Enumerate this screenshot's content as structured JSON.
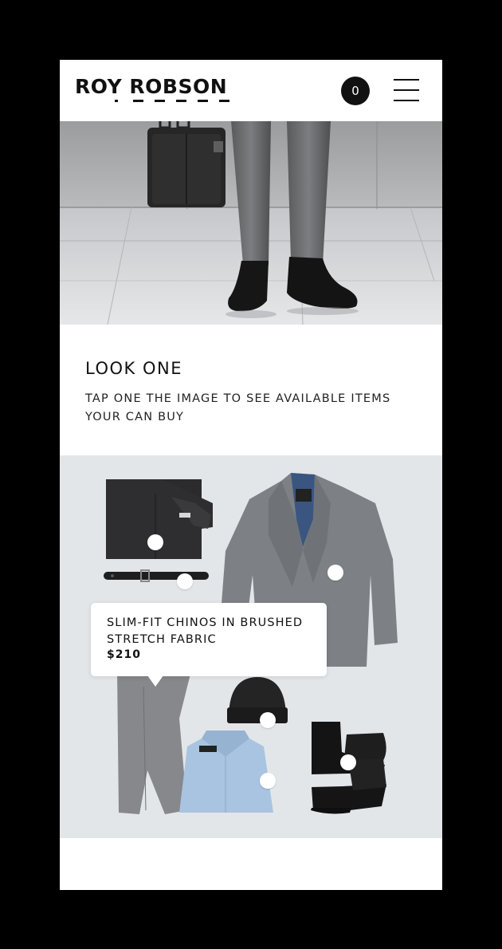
{
  "header": {
    "brand": "ROY ROBSON",
    "cart_count": "0"
  },
  "look": {
    "title": "LOOK ONE",
    "subtitle": "TAP ONE THE IMAGE TO SEE AVAILABLE ITEMS YOUR CAN BUY"
  },
  "tooltip": {
    "name": "SLIM-FIT CHINOS IN BRUSHED STRETCH FABRIC",
    "price": "$210"
  },
  "icons": {
    "cart": "cart-count-badge",
    "menu": "hamburger-menu-icon",
    "hotspot": "product-hotspot-dot"
  },
  "colors": {
    "background": "#000000",
    "screen": "#ffffff",
    "text": "#111111",
    "flatlay_bg": "#e3e6e9"
  }
}
